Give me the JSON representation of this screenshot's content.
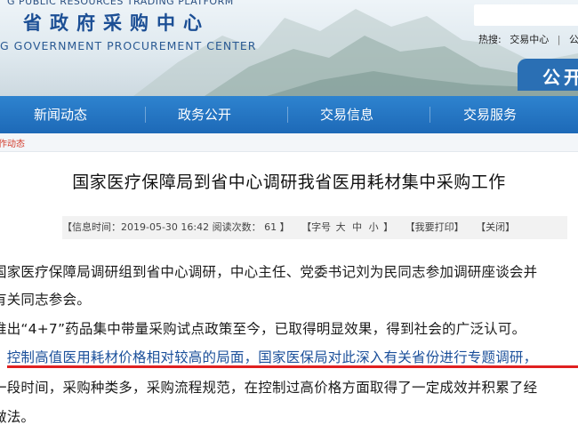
{
  "header": {
    "top_english": "G PUBLIC RESOURCES TRADING PLATFORM",
    "chinese_title": "省政府采购中心",
    "english_title": "G GOVERNMENT PROCUREMENT CENTER",
    "hot_label": "热搜:",
    "hot_links": [
      "交易中心",
      "公"
    ],
    "public_badge": "公开"
  },
  "nav": {
    "items": [
      "新闻动态",
      "政务公开",
      "交易信息",
      "交易服务"
    ]
  },
  "breadcrumb": "作动态",
  "article": {
    "title": "国家医疗保障局到省中心调研我省医用耗材集中采购工作",
    "meta": {
      "info_time": "【信息时间：2019-05-30 16:42  阅读次数：  61 】",
      "font_label": "【字号",
      "font_sizes": [
        "大",
        "中",
        "小"
      ],
      "font_end": "】",
      "print": "【我要打印】",
      "close": "【关闭】"
    },
    "paragraphs": [
      "国家医疗保障局调研组到省中心调研，中心主任、党委书记刘为民同志参加调研座谈会并",
      "有关同志参会。",
      "推出“4+7”药品集中带量采购试点政策至今，已取得明显效果，得到社会的广泛认可。",
      "、控制高值医用耗材价格相对较高的局面，国家医保局对此深入有关省份进行专题调研，",
      "一段时间，采购种类多，采购流程规范，在控制过高价格方面取得了一定成效并积累了经",
      "做法。"
    ]
  },
  "colors": {
    "nav_blue": "#1d69b7",
    "title_blue": "#1c4f95",
    "breadcrumb_red": "#d23a2a",
    "underline_red": "#e02020",
    "highlight_text": "#1a4f9a"
  }
}
